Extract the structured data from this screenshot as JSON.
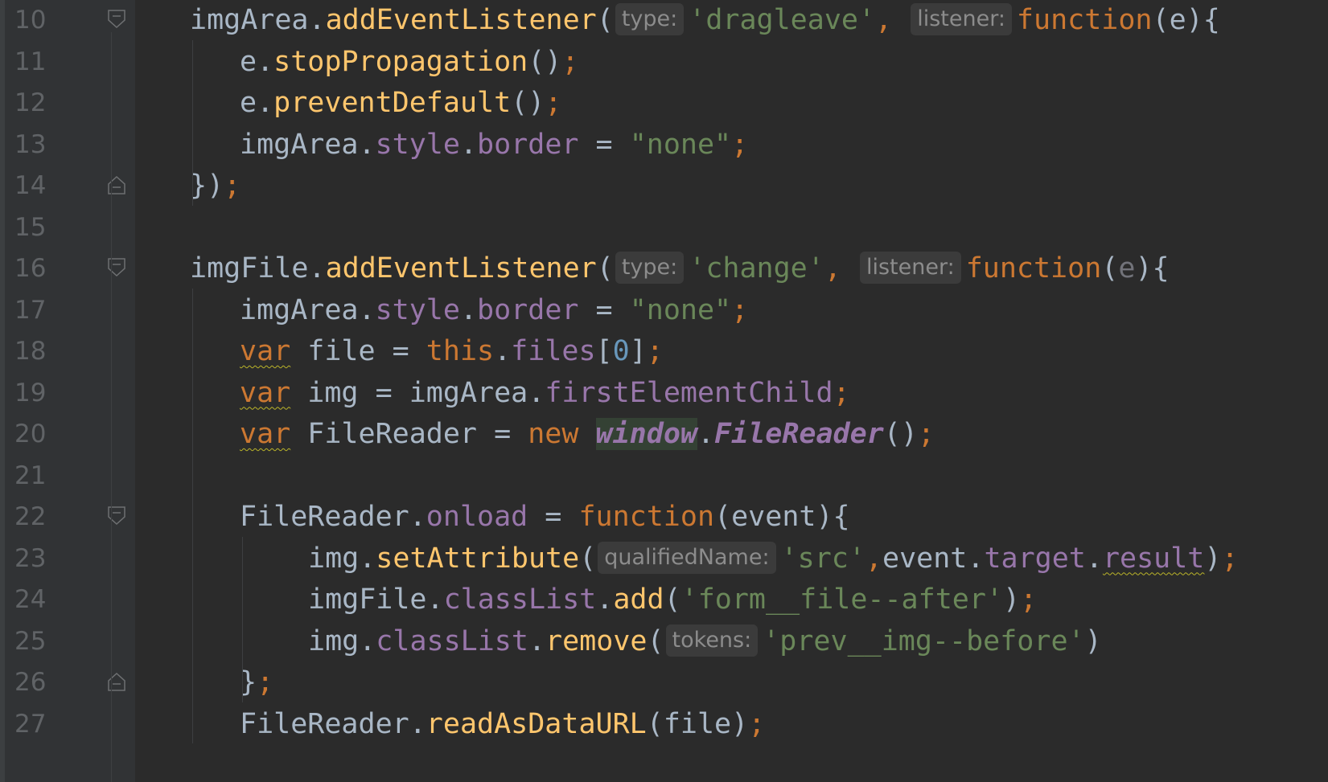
{
  "editor": {
    "language": "javascript",
    "colors": {
      "background": "#2b2b2b",
      "gutter": "#313335",
      "line_number": "#606366",
      "identifier": "#a9b7c6",
      "method": "#ffc66d",
      "property": "#9876aa",
      "keyword": "#cc7832",
      "string": "#6a8759",
      "number": "#6897bb",
      "unused": "#72737a",
      "inlay_hint_background": "#3b3b3b",
      "inlay_hint_text": "#8c8c8c",
      "warning_underline": "#bbb529"
    },
    "lines": [
      {
        "number": "10",
        "fold": "open",
        "indent": 1,
        "tokens": [
          {
            "t": "ident",
            "v": "imgArea"
          },
          {
            "t": "punct",
            "v": "."
          },
          {
            "t": "method",
            "v": "addEventListener"
          },
          {
            "t": "punct",
            "v": "("
          },
          {
            "t": "hint",
            "v": "type:"
          },
          {
            "t": "string",
            "v": "'dragleave'"
          },
          {
            "t": "semicolon",
            "v": ", "
          },
          {
            "t": "hint",
            "v": "listener:"
          },
          {
            "t": "keyword",
            "v": "function"
          },
          {
            "t": "punct",
            "v": "("
          },
          {
            "t": "param",
            "v": "e"
          },
          {
            "t": "punct",
            "v": "){"
          }
        ]
      },
      {
        "number": "11",
        "fold": null,
        "indent": 2,
        "tokens": [
          {
            "t": "ident",
            "v": "e"
          },
          {
            "t": "punct",
            "v": "."
          },
          {
            "t": "method",
            "v": "stopPropagation"
          },
          {
            "t": "punct",
            "v": "()"
          },
          {
            "t": "semicolon",
            "v": ";"
          }
        ]
      },
      {
        "number": "12",
        "fold": null,
        "indent": 2,
        "tokens": [
          {
            "t": "ident",
            "v": "e"
          },
          {
            "t": "punct",
            "v": "."
          },
          {
            "t": "method",
            "v": "preventDefault"
          },
          {
            "t": "punct",
            "v": "()"
          },
          {
            "t": "semicolon",
            "v": ";"
          }
        ]
      },
      {
        "number": "13",
        "fold": null,
        "indent": 2,
        "tokens": [
          {
            "t": "ident",
            "v": "imgArea"
          },
          {
            "t": "punct",
            "v": "."
          },
          {
            "t": "prop",
            "v": "style"
          },
          {
            "t": "punct",
            "v": "."
          },
          {
            "t": "prop",
            "v": "border"
          },
          {
            "t": "punct",
            "v": " = "
          },
          {
            "t": "string",
            "v": "\"none\""
          },
          {
            "t": "semicolon",
            "v": ";"
          }
        ]
      },
      {
        "number": "14",
        "fold": "close",
        "indent": 1,
        "tokens": [
          {
            "t": "punct",
            "v": "})"
          },
          {
            "t": "semicolon",
            "v": ";"
          }
        ]
      },
      {
        "number": "15",
        "fold": null,
        "indent": 1,
        "tokens": []
      },
      {
        "number": "16",
        "fold": "open",
        "indent": 1,
        "tokens": [
          {
            "t": "ident",
            "v": "imgFile"
          },
          {
            "t": "punct",
            "v": "."
          },
          {
            "t": "method",
            "v": "addEventListener"
          },
          {
            "t": "punct",
            "v": "("
          },
          {
            "t": "hint",
            "v": "type:"
          },
          {
            "t": "string",
            "v": "'change'"
          },
          {
            "t": "semicolon",
            "v": ", "
          },
          {
            "t": "hint",
            "v": "listener:"
          },
          {
            "t": "keyword",
            "v": "function"
          },
          {
            "t": "punct",
            "v": "("
          },
          {
            "t": "unused",
            "v": "e"
          },
          {
            "t": "punct",
            "v": "){"
          }
        ]
      },
      {
        "number": "17",
        "fold": null,
        "indent": 2,
        "tokens": [
          {
            "t": "ident",
            "v": "imgArea"
          },
          {
            "t": "punct",
            "v": "."
          },
          {
            "t": "prop",
            "v": "style"
          },
          {
            "t": "punct",
            "v": "."
          },
          {
            "t": "prop",
            "v": "border"
          },
          {
            "t": "punct",
            "v": " = "
          },
          {
            "t": "string",
            "v": "\"none\""
          },
          {
            "t": "semicolon",
            "v": ";"
          }
        ]
      },
      {
        "number": "18",
        "fold": null,
        "indent": 2,
        "tokens": [
          {
            "t": "keyword",
            "v": "var",
            "warn": true
          },
          {
            "t": "ident",
            "v": " file"
          },
          {
            "t": "punct",
            "v": " = "
          },
          {
            "t": "keyword",
            "v": "this"
          },
          {
            "t": "punct",
            "v": "."
          },
          {
            "t": "prop",
            "v": "files"
          },
          {
            "t": "punct",
            "v": "["
          },
          {
            "t": "number",
            "v": "0"
          },
          {
            "t": "punct",
            "v": "]"
          },
          {
            "t": "semicolon",
            "v": ";"
          }
        ]
      },
      {
        "number": "19",
        "fold": null,
        "indent": 2,
        "tokens": [
          {
            "t": "keyword",
            "v": "var",
            "warn": true
          },
          {
            "t": "ident",
            "v": " img"
          },
          {
            "t": "punct",
            "v": " = "
          },
          {
            "t": "ident",
            "v": "imgArea"
          },
          {
            "t": "punct",
            "v": "."
          },
          {
            "t": "prop",
            "v": "firstElementChild"
          },
          {
            "t": "semicolon",
            "v": ";"
          }
        ]
      },
      {
        "number": "20",
        "fold": null,
        "indent": 2,
        "tokens": [
          {
            "t": "keyword",
            "v": "var",
            "warn": true
          },
          {
            "t": "ident",
            "v": " FileReader"
          },
          {
            "t": "punct",
            "v": " = "
          },
          {
            "t": "keyword",
            "v": "new "
          },
          {
            "t": "global",
            "v": "window",
            "highlight": true
          },
          {
            "t": "punct",
            "v": "."
          },
          {
            "t": "global",
            "v": "FileReader"
          },
          {
            "t": "punct",
            "v": "()"
          },
          {
            "t": "semicolon",
            "v": ";"
          }
        ]
      },
      {
        "number": "21",
        "fold": null,
        "indent": 2,
        "tokens": []
      },
      {
        "number": "22",
        "fold": "open",
        "indent": 2,
        "tokens": [
          {
            "t": "ident",
            "v": "FileReader"
          },
          {
            "t": "punct",
            "v": "."
          },
          {
            "t": "prop",
            "v": "onload"
          },
          {
            "t": "punct",
            "v": " = "
          },
          {
            "t": "keyword",
            "v": "function"
          },
          {
            "t": "punct",
            "v": "("
          },
          {
            "t": "param",
            "v": "event"
          },
          {
            "t": "punct",
            "v": "){"
          }
        ]
      },
      {
        "number": "23",
        "fold": null,
        "indent": 3,
        "tokens": [
          {
            "t": "ident",
            "v": "img"
          },
          {
            "t": "punct",
            "v": "."
          },
          {
            "t": "method",
            "v": "setAttribute"
          },
          {
            "t": "punct",
            "v": "("
          },
          {
            "t": "hint",
            "v": "qualifiedName:"
          },
          {
            "t": "string",
            "v": "'src'"
          },
          {
            "t": "semicolon",
            "v": ","
          },
          {
            "t": "ident",
            "v": "event"
          },
          {
            "t": "punct",
            "v": "."
          },
          {
            "t": "prop",
            "v": "target"
          },
          {
            "t": "punct",
            "v": "."
          },
          {
            "t": "prop",
            "v": "result",
            "warn": true
          },
          {
            "t": "punct",
            "v": ")"
          },
          {
            "t": "semicolon",
            "v": ";"
          }
        ]
      },
      {
        "number": "24",
        "fold": null,
        "indent": 3,
        "tokens": [
          {
            "t": "ident",
            "v": "imgFile"
          },
          {
            "t": "punct",
            "v": "."
          },
          {
            "t": "prop",
            "v": "classList"
          },
          {
            "t": "punct",
            "v": "."
          },
          {
            "t": "method",
            "v": "add"
          },
          {
            "t": "punct",
            "v": "("
          },
          {
            "t": "string",
            "v": "'form__file--after'"
          },
          {
            "t": "punct",
            "v": ")"
          },
          {
            "t": "semicolon",
            "v": ";"
          }
        ]
      },
      {
        "number": "25",
        "fold": null,
        "indent": 3,
        "tokens": [
          {
            "t": "ident",
            "v": "img"
          },
          {
            "t": "punct",
            "v": "."
          },
          {
            "t": "prop",
            "v": "classList"
          },
          {
            "t": "punct",
            "v": "."
          },
          {
            "t": "method",
            "v": "remove"
          },
          {
            "t": "punct",
            "v": "("
          },
          {
            "t": "hint",
            "v": "tokens:"
          },
          {
            "t": "string",
            "v": "'prev__img--before'"
          },
          {
            "t": "punct",
            "v": ")"
          }
        ]
      },
      {
        "number": "26",
        "fold": "close",
        "indent": 2,
        "tokens": [
          {
            "t": "punct",
            "v": "}"
          },
          {
            "t": "semicolon",
            "v": ";"
          }
        ]
      },
      {
        "number": "27",
        "fold": null,
        "indent": 2,
        "tokens": [
          {
            "t": "ident",
            "v": "FileReader"
          },
          {
            "t": "punct",
            "v": "."
          },
          {
            "t": "method",
            "v": "readAsDataURL"
          },
          {
            "t": "punct",
            "v": "("
          },
          {
            "t": "ident",
            "v": "file"
          },
          {
            "t": "punct",
            "v": ")"
          },
          {
            "t": "semicolon",
            "v": ";"
          }
        ]
      }
    ]
  }
}
